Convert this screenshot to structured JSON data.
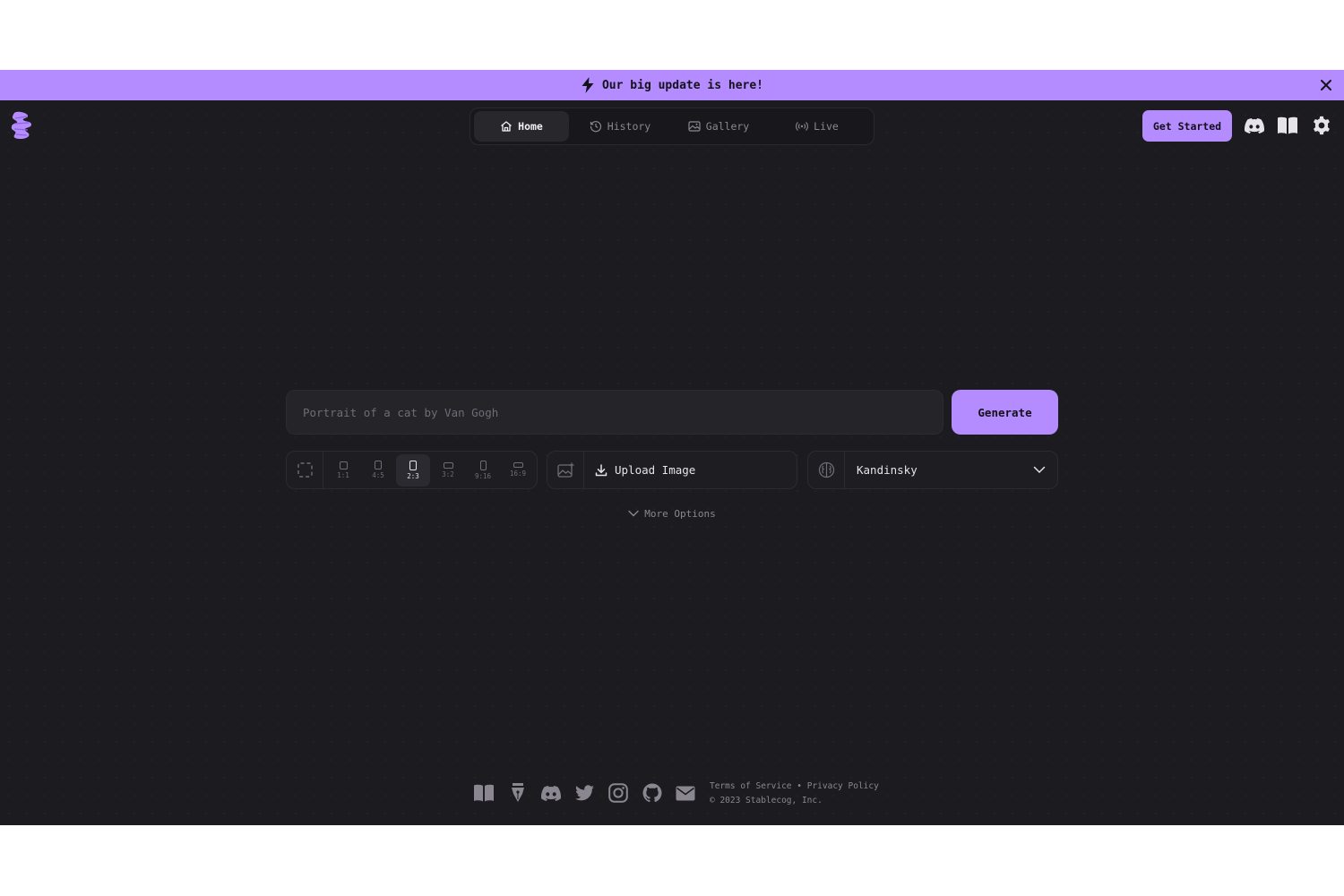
{
  "banner": {
    "text": "Our big update is here!"
  },
  "nav": {
    "tabs": [
      {
        "label": "Home",
        "active": true
      },
      {
        "label": "History"
      },
      {
        "label": "Gallery"
      },
      {
        "label": "Live"
      }
    ]
  },
  "header": {
    "cta_label": "Get Started"
  },
  "prompt": {
    "placeholder": "Portrait of a cat by Van Gogh",
    "value": ""
  },
  "generate_label": "Generate",
  "aspect_ratios": {
    "options": [
      "1:1",
      "4:5",
      "2:3",
      "3:2",
      "9:16",
      "16:9"
    ],
    "selected": "2:3"
  },
  "upload": {
    "label": "Upload Image"
  },
  "model": {
    "selected": "Kandinsky"
  },
  "more_options_label": "More Options",
  "footer": {
    "terms": "Terms of Service",
    "separator": "•",
    "privacy": "Privacy Policy",
    "copyright": "© 2023 Stablecog, Inc."
  },
  "colors": {
    "accent": "#b48cff",
    "background": "#1c1b1f",
    "surface": "#252429",
    "muted": "#8a8791"
  }
}
